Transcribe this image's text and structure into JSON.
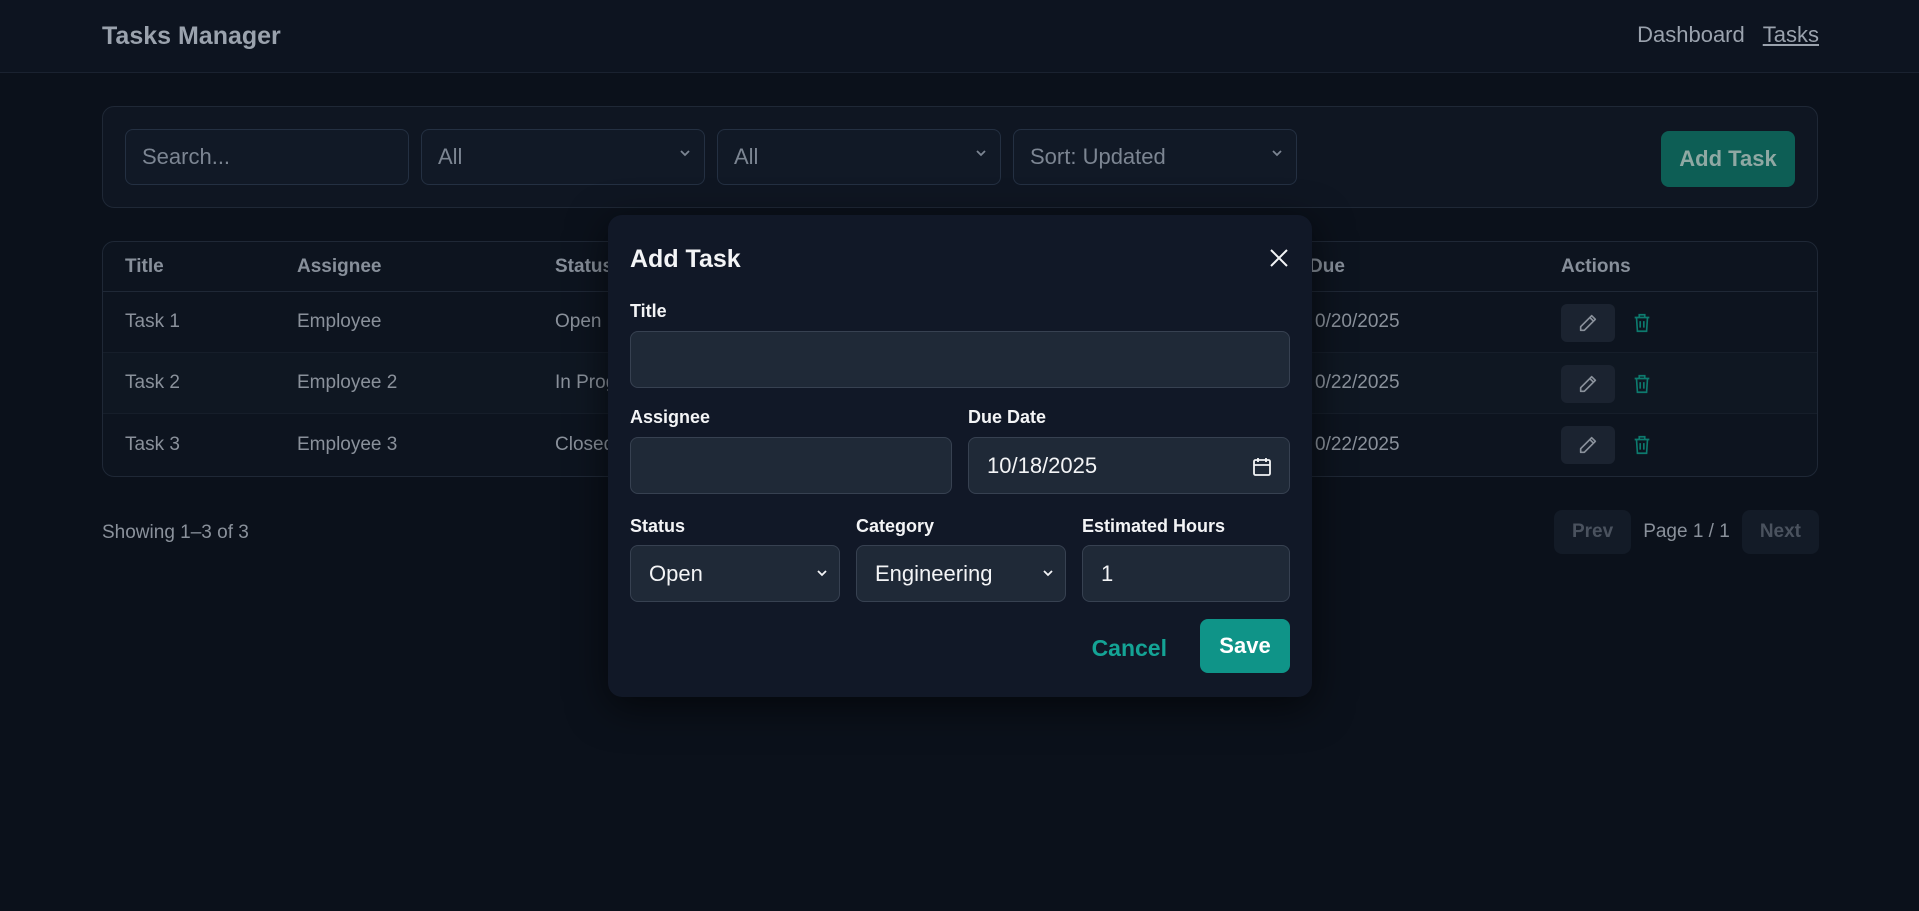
{
  "header": {
    "brand": "Tasks Manager",
    "nav": [
      {
        "label": "Dashboard",
        "active": false
      },
      {
        "label": "Tasks",
        "active": true
      }
    ]
  },
  "toolbar": {
    "search_placeholder": "Search...",
    "filter1": "All",
    "filter2": "All",
    "sort": "Sort: Updated",
    "add_label": "Add Task"
  },
  "table": {
    "columns": [
      "Title",
      "Assignee",
      "Status",
      "Due",
      "Actions"
    ],
    "rows": [
      {
        "title": "Task 1",
        "assignee": "Employee",
        "status": "Open",
        "due": "0/20/2025"
      },
      {
        "title": "Task 2",
        "assignee": "Employee 2",
        "status": "In Prog",
        "due": "0/22/2025"
      },
      {
        "title": "Task 3",
        "assignee": "Employee 3",
        "status": "Closed",
        "due": "0/22/2025"
      }
    ]
  },
  "footer": {
    "showing": "Showing 1–3 of 3",
    "prev": "Prev",
    "page": "Page 1 / 1",
    "next": "Next"
  },
  "modal": {
    "title": "Add Task",
    "labels": {
      "title": "Title",
      "assignee": "Assignee",
      "due": "Due Date",
      "status": "Status",
      "category": "Category",
      "hours": "Estimated Hours"
    },
    "values": {
      "title": "",
      "assignee": "",
      "due": "10/18/2025",
      "status": "Open",
      "category": "Engineering",
      "hours": "1"
    },
    "cancel": "Cancel",
    "save": "Save"
  },
  "colors": {
    "accent": "#0f9488",
    "background": "#0b111b",
    "modal": "#111827"
  }
}
